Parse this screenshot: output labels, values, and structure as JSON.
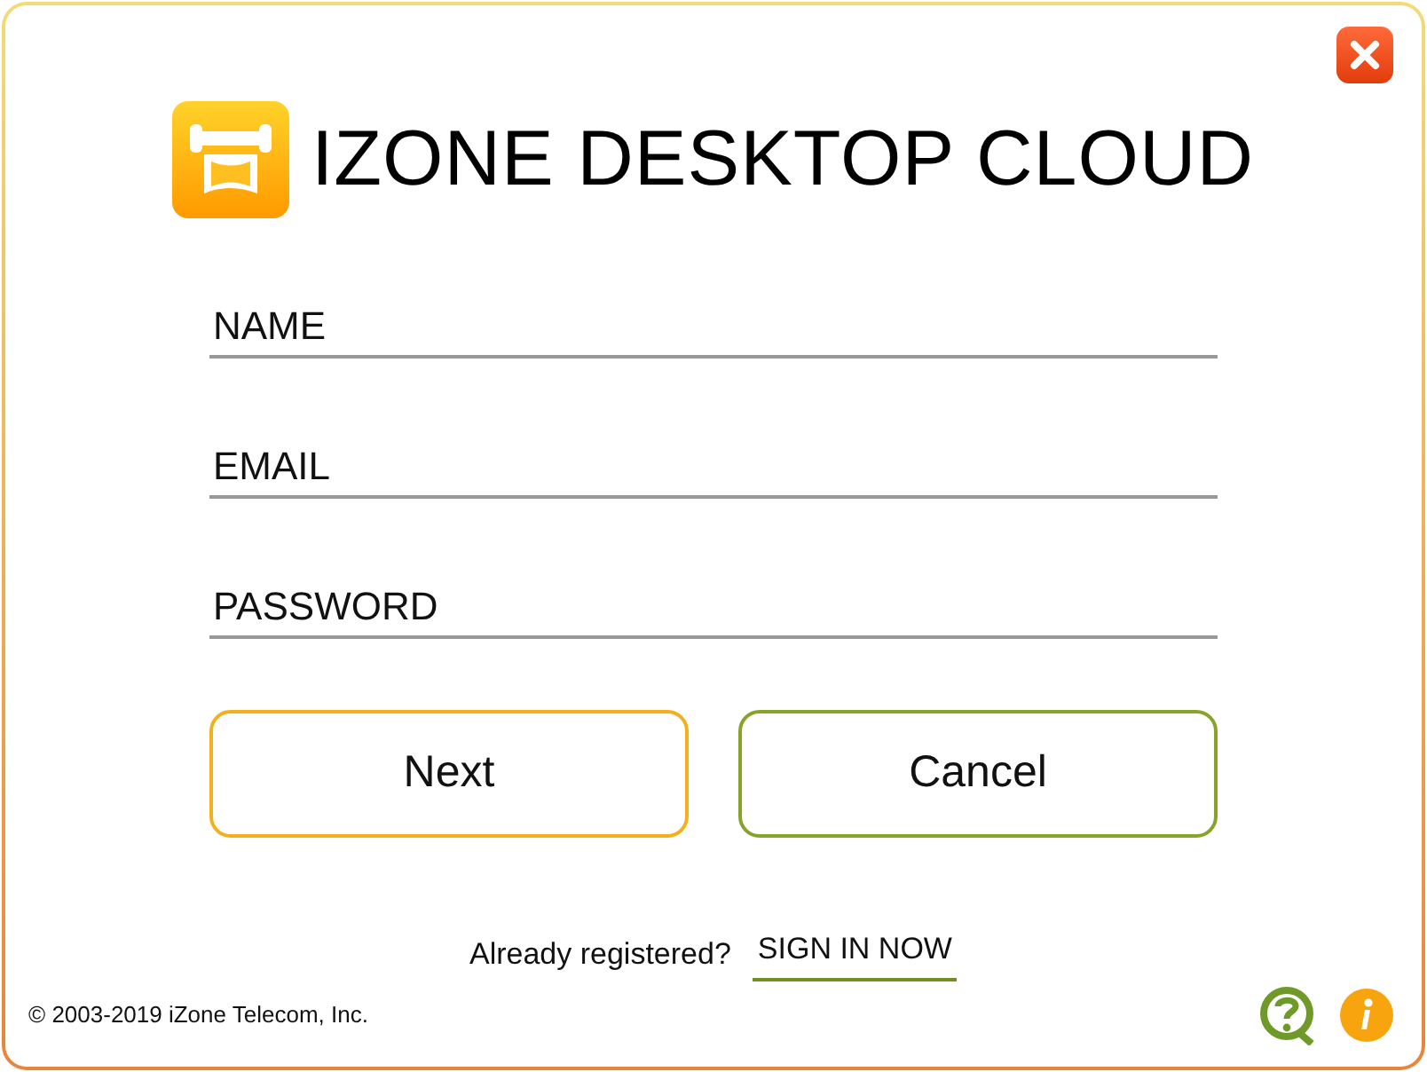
{
  "title": "IZONE DESKTOP CLOUD",
  "fields": [
    {
      "placeholder": "NAME"
    },
    {
      "placeholder": "EMAIL"
    },
    {
      "placeholder": "PASSWORD"
    }
  ],
  "buttons": [
    {
      "label": "Next",
      "kind": "primary"
    },
    {
      "label": "Cancel",
      "kind": "secondary"
    }
  ],
  "signin": {
    "prompt": "Already registered?",
    "link": "SIGN IN NOW"
  },
  "copyright": "© 2003-2019 iZone Telecom, Inc."
}
